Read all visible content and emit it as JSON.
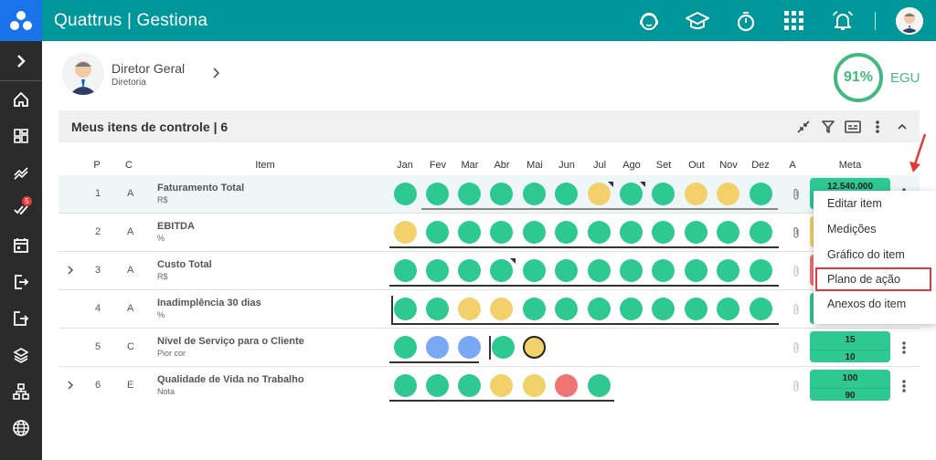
{
  "app": {
    "title": "Quattrus | Gestiona"
  },
  "topbar": {
    "icons": [
      "support-icon",
      "graduation-cap-icon",
      "stopwatch-icon",
      "apps-grid-icon",
      "alarm-bell-icon"
    ]
  },
  "sidebar": {
    "items": [
      {
        "icon": "chevron-right-icon"
      },
      {
        "icon": "home-icon"
      },
      {
        "icon": "dashboard-icon"
      },
      {
        "icon": "trend-icon"
      },
      {
        "icon": "tasks-icon",
        "badge": "5"
      },
      {
        "icon": "calendar-icon"
      },
      {
        "icon": "login-icon"
      },
      {
        "icon": "export-icon"
      },
      {
        "icon": "layers-icon"
      },
      {
        "icon": "org-chart-icon"
      },
      {
        "icon": "globe-icon"
      }
    ]
  },
  "user": {
    "name": "Diretor Geral",
    "role": "Diretoria"
  },
  "egu": {
    "value": "91%",
    "label": "EGU"
  },
  "panel": {
    "title": "Meus itens de controle | 6"
  },
  "columns": {
    "p": "P",
    "c": "C",
    "item": "Item",
    "months": [
      "Jan",
      "Fev",
      "Mar",
      "Abr",
      "Mai",
      "Jun",
      "Jul",
      "Ago",
      "Set",
      "Out",
      "Nov",
      "Dez"
    ],
    "a": "A",
    "meta": "Meta"
  },
  "rows": [
    {
      "p": "1",
      "c": "A",
      "name": "Faturamento Total",
      "unit": "R$",
      "meta_top": "12.540.000",
      "meta_bottom": "",
      "expandable": false
    },
    {
      "p": "2",
      "c": "A",
      "name": "EBITDA",
      "unit": "%",
      "meta_top": "",
      "meta_bottom": "",
      "expandable": false
    },
    {
      "p": "3",
      "c": "A",
      "name": "Custo Total",
      "unit": "R$",
      "meta_top": "",
      "meta_bottom": "",
      "expandable": true
    },
    {
      "p": "4",
      "c": "A",
      "name": "Inadimplência 30 dias",
      "unit": "%",
      "meta_top": "",
      "meta_bottom": "",
      "expandable": false
    },
    {
      "p": "5",
      "c": "C",
      "name": "Nível de Serviço para o Cliente",
      "unit": "Pior cor",
      "meta_top": "15",
      "meta_bottom": "10",
      "expandable": false
    },
    {
      "p": "6",
      "c": "E",
      "name": "Qualidade de Vida no Trabalho",
      "unit": "Nota",
      "meta_top": "100",
      "meta_bottom": "90",
      "expandable": true
    }
  ],
  "status_colors": {
    "green": "#2ec893",
    "yellow": "#f2d16b",
    "blue": "#7aa8f5",
    "red": "#f07474"
  },
  "context_menu": {
    "items": [
      "Editar item",
      "Medições",
      "Gráfico do item",
      "Plano de ação",
      "Anexos do item"
    ]
  }
}
